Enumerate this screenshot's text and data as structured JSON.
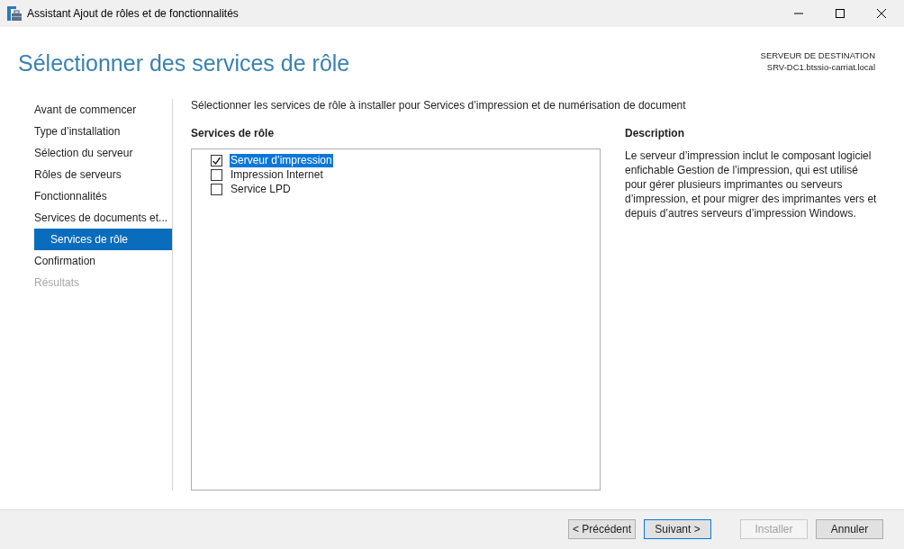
{
  "window": {
    "title": "Assistant Ajout de rôles et de fonctionnalités"
  },
  "header": {
    "title": "Sélectionner des services de rôle",
    "destination_label": "SERVEUR DE DESTINATION",
    "destination_server": "SRV-DC1.btssio-carriat.local"
  },
  "steps": [
    {
      "label": "Avant de commencer",
      "selected": false,
      "disabled": false
    },
    {
      "label": "Type d’installation",
      "selected": false,
      "disabled": false
    },
    {
      "label": "Sélection du serveur",
      "selected": false,
      "disabled": false
    },
    {
      "label": "Rôles de serveurs",
      "selected": false,
      "disabled": false
    },
    {
      "label": "Fonctionnalités",
      "selected": false,
      "disabled": false
    },
    {
      "label": "Services de documents et...",
      "selected": false,
      "disabled": false,
      "children": [
        {
          "label": "Services de rôle",
          "selected": true,
          "disabled": false
        }
      ]
    },
    {
      "label": "Confirmation",
      "selected": false,
      "disabled": false
    },
    {
      "label": "Résultats",
      "selected": false,
      "disabled": true
    }
  ],
  "instruction": "Sélectionner les services de rôle à installer pour Services d’impression et de numérisation de document",
  "role_services": {
    "heading": "Services de rôle",
    "items": [
      {
        "label": "Serveur d’impression",
        "checked": true,
        "selected": true
      },
      {
        "label": "Impression Internet",
        "checked": false,
        "selected": false
      },
      {
        "label": "Service LPD",
        "checked": false,
        "selected": false
      }
    ]
  },
  "description": {
    "heading": "Description",
    "text": "Le serveur d’impression inclut le composant logiciel enfichable Gestion de l’impression, qui est utilisé pour gérer plusieurs imprimantes ou serveurs d’impression, et pour migrer des imprimantes vers et depuis d’autres serveurs d’impression Windows."
  },
  "buttons": [
    {
      "label": "< Précédent",
      "default": false,
      "disabled": false
    },
    {
      "label": "Suivant >",
      "default": true,
      "disabled": false
    },
    {
      "label": "Installer",
      "default": false,
      "disabled": true
    },
    {
      "label": "Annuler",
      "default": false,
      "disabled": false
    }
  ]
}
